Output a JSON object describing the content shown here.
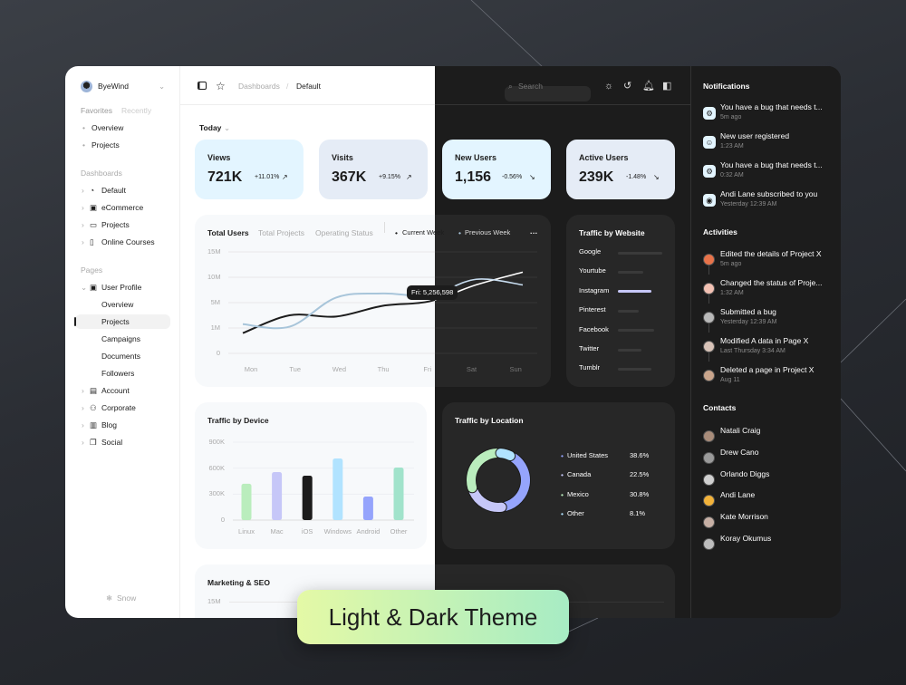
{
  "colors": {
    "accent_light_blue": "#e3f5ff",
    "accent_light_gray": "#e5ecf6",
    "dark_bg": "#1c1c1c",
    "banner_from": "#e4f9a6",
    "banner_to": "#a7ecc4"
  },
  "sidebar": {
    "user": "ByeWind",
    "tabs": [
      "Favorites",
      "Recently"
    ],
    "favorites": [
      "Overview",
      "Projects"
    ],
    "dashboards_title": "Dashboards",
    "dashboards": [
      {
        "label": "Default",
        "icon": "pie-chart-icon"
      },
      {
        "label": "eCommerce",
        "icon": "shopping-bag-icon"
      },
      {
        "label": "Projects",
        "icon": "folder-icon"
      },
      {
        "label": "Online Courses",
        "icon": "book-icon"
      }
    ],
    "pages_title": "Pages",
    "user_profile": "User Profile",
    "user_profile_children": [
      "Overview",
      "Projects",
      "Campaigns",
      "Documents",
      "Followers"
    ],
    "active_child": "Projects",
    "pages": [
      {
        "label": "Account",
        "icon": "id-card-icon"
      },
      {
        "label": "Corporate",
        "icon": "users-icon"
      },
      {
        "label": "Blog",
        "icon": "blog-icon"
      },
      {
        "label": "Social",
        "icon": "chat-icon"
      }
    ],
    "footer": "Snow"
  },
  "header": {
    "breadcrumb": [
      "Dashboards",
      "Default"
    ],
    "search_placeholder": "Search"
  },
  "main": {
    "period": "Today",
    "stats": [
      {
        "title": "Views",
        "value": "721K",
        "change": "+11.01%",
        "trend": "up"
      },
      {
        "title": "Visits",
        "value": "367K",
        "change": "+9.15%",
        "trend": "up"
      },
      {
        "title": "New Users",
        "value": "1,156",
        "change": "-0.56%",
        "trend": "down"
      },
      {
        "title": "Active Users",
        "value": "239K",
        "change": "-1.48%",
        "trend": "down"
      }
    ],
    "users_tabs": [
      "Total Users",
      "Total Projects",
      "Operating Status"
    ],
    "traffic_website": {
      "title": "Traffic by Website",
      "sites": [
        {
          "name": "Google",
          "value": 1.0
        },
        {
          "name": "Yourtube",
          "value": 0.57
        },
        {
          "name": "Instagram",
          "value": 0.76,
          "highlight": true
        },
        {
          "name": "Pinterest",
          "value": 0.47
        },
        {
          "name": "Facebook",
          "value": 0.82
        },
        {
          "name": "Twitter",
          "value": 0.53
        },
        {
          "name": "Tumblr",
          "value": 0.76
        }
      ]
    },
    "marketing": {
      "title": "Marketing & SEO",
      "first_tick": "15M"
    }
  },
  "chart_data": [
    {
      "type": "line",
      "title": "Total Users",
      "legend_placement": "top",
      "x": [
        "Mon",
        "Tue",
        "Wed",
        "Thu",
        "Fri",
        "Sat",
        "Sun"
      ],
      "yticks": [
        "0",
        "1M",
        "5M",
        "10M",
        "15M"
      ],
      "ytick_values": [
        0,
        1,
        5,
        10,
        15
      ],
      "ylim": [
        0,
        15
      ],
      "grid": true,
      "series": [
        {
          "name": "Current Week",
          "values": [
            0.8,
            3.0,
            2.8,
            4.5,
            5.26,
            8.5,
            11.0
          ],
          "color": "#1c1c1c"
        },
        {
          "name": "Previous Week",
          "values": [
            1.6,
            1.2,
            6.0,
            6.8,
            6.5,
            9.6,
            8.5
          ],
          "color": "#a8c5da"
        }
      ],
      "tooltip": "Fri: 5,256,598"
    },
    {
      "type": "bar",
      "title": "Traffic by Device",
      "categories": [
        "Linux",
        "Mac",
        "iOS",
        "Windows",
        "Android",
        "Other"
      ],
      "values": [
        420,
        555,
        513,
        712,
        272,
        607
      ],
      "colors": [
        "#baedbd",
        "#c6c7f8",
        "#1c1c1c",
        "#b1e3ff",
        "#95a4fc",
        "#a1e3cb"
      ],
      "yticks": [
        "0",
        "300K",
        "600K",
        "900K"
      ],
      "ylim": [
        0,
        900
      ],
      "unit": "K",
      "grid": true
    },
    {
      "type": "pie",
      "title": "Traffic by Location",
      "donut": true,
      "labels": [
        "United States",
        "Canada",
        "Mexico",
        "Other"
      ],
      "display": [
        "38.6%",
        "22.5%",
        "30.8%",
        "8.1%"
      ],
      "values": [
        38.6,
        22.5,
        30.8,
        8.1
      ],
      "colors": [
        "#95a4fc",
        "#c6c7f8",
        "#baedbd",
        "#b1e3ff"
      ]
    }
  ],
  "right": {
    "notifications_title": "Notifications",
    "notifications": [
      {
        "text": "You have a bug that needs t...",
        "time": "5m ago",
        "icon": "bug-icon"
      },
      {
        "text": "New user registered",
        "time": "1:23 AM",
        "icon": "user-icon"
      },
      {
        "text": "You have a bug that needs t...",
        "time": "0:32 AM",
        "icon": "bug-icon"
      },
      {
        "text": "Andi Lane subscribed to you",
        "time": "Yesterday 12:39 AM",
        "icon": "broadcast-icon"
      }
    ],
    "activities_title": "Activities",
    "activities": [
      {
        "text": "Edited the details of Project X",
        "time": "5m ago"
      },
      {
        "text": "Changed the status of Proje...",
        "time": "1:32 AM"
      },
      {
        "text": "Submitted a bug",
        "time": "Yesterday 12:39 AM"
      },
      {
        "text": "Modified A data in Page X",
        "time": "Last Thursday 3:34 AM"
      },
      {
        "text": "Deleted a page in Project X",
        "time": "Aug 11"
      }
    ],
    "contacts_title": "Contacts",
    "contacts": [
      "Natali Craig",
      "Drew Cano",
      "Orlando Diggs",
      "Andi Lane",
      "Kate Morrison",
      "Koray Okumus"
    ]
  },
  "banner": "Light & Dark Theme"
}
